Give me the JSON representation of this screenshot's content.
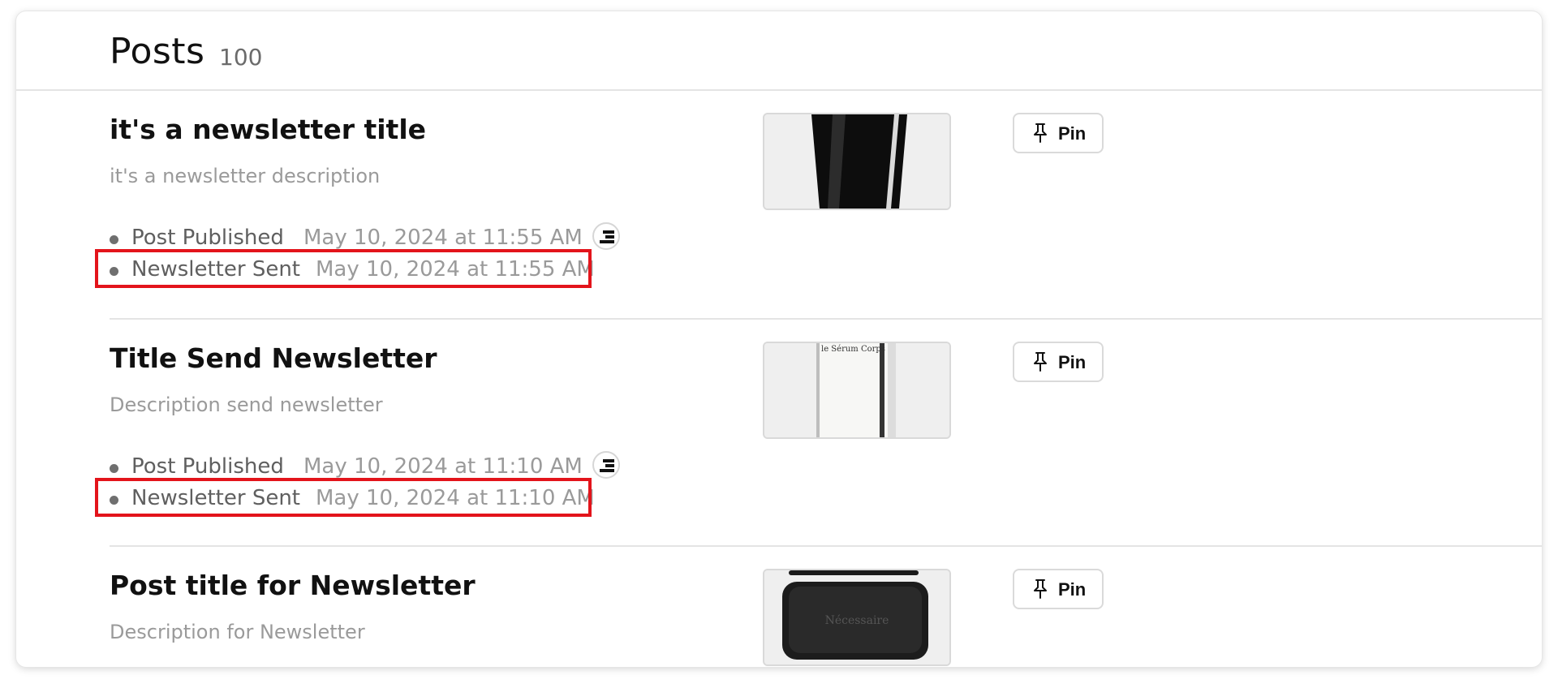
{
  "header": {
    "title": "Posts",
    "count": "100"
  },
  "posts": [
    {
      "title": "it's a newsletter title",
      "description": "it's a newsletter description",
      "published_label": "Post Published",
      "published_date": "May 10, 2024 at 11:55 AM",
      "sent_label": "Newsletter Sent",
      "sent_date": "May 10, 2024 at 11:55 AM",
      "pin_label": "Pin",
      "thumbnail_icon": "black-tube-product-image"
    },
    {
      "title": "Title Send Newsletter",
      "description": "Description send newsletter",
      "published_label": "Post Published",
      "published_date": "May 10, 2024 at 11:10 AM",
      "sent_label": "Newsletter Sent",
      "sent_date": "May 10, 2024 at 11:10 AM",
      "pin_label": "Pin",
      "thumbnail_icon": "white-bottle-product-image",
      "thumbnail_text": "le Sérum Corps"
    },
    {
      "title": "Post title for Newsletter",
      "description": "Description for Newsletter",
      "pin_label": "Pin",
      "thumbnail_icon": "black-soap-bar-image",
      "thumbnail_text": "Nécessaire"
    }
  ],
  "colors": {
    "highlight": "#e3141b",
    "muted_text": "#9a9a9a",
    "label_text": "#5f5f5f"
  }
}
